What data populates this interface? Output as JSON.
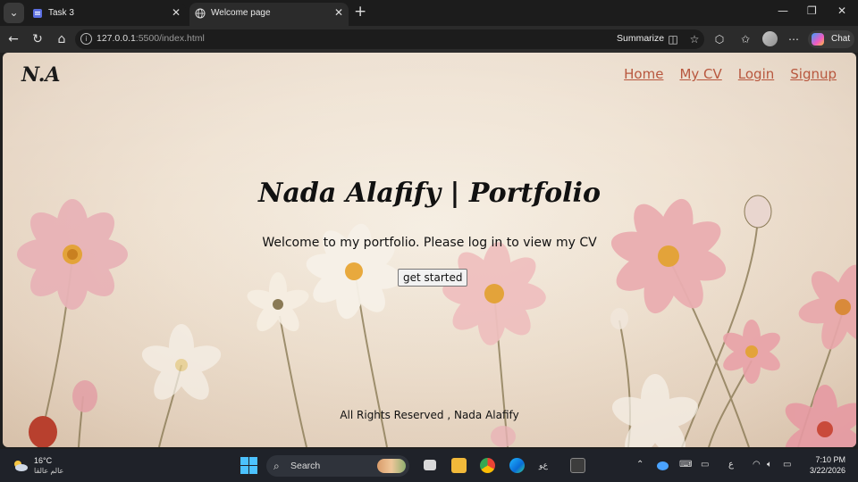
{
  "browser": {
    "tabs": [
      {
        "label": "Task 3",
        "active": false
      },
      {
        "label": "Welcome page",
        "active": true
      }
    ],
    "url_host": "127.0.0.1",
    "url_rest": ":5500/index.html",
    "summarize_label": "Summarize",
    "chat_label": "Chat"
  },
  "page": {
    "logo": "N.A",
    "nav": [
      "Home",
      "My CV",
      "Login",
      "Signup"
    ],
    "title": "Nada Alafify | Portfolio",
    "subtitle": "Welcome to my portfolio. Please log in to view my CV",
    "cta_label": "get started",
    "footer": "All Rights Reserved , Nada Alafify",
    "colors": {
      "nav_link": "#b8573e",
      "heading": "#111111"
    }
  },
  "taskbar": {
    "weather_temp": "16°C",
    "weather_condition": "عالم عالقا",
    "search_label": "Search",
    "lang": "ع",
    "time": "7:10 PM",
    "date": "3/22/2026"
  }
}
